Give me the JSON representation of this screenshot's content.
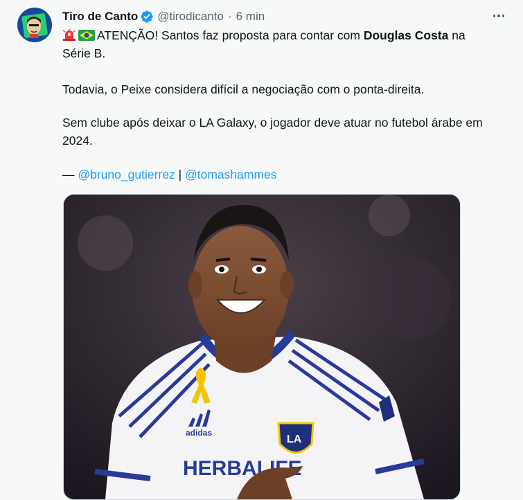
{
  "tweet": {
    "author_name": "Tiro de Canto",
    "handle": "@tirodicanto",
    "separator": "·",
    "time": "6 min",
    "line1_text": "ATENÇÃO! Santos faz proposta para contar com ",
    "line1_bold": "Douglas Costa",
    "line1_after": " na",
    "line2": "Série B.",
    "paragraph2": "Todavia, o Peixe considera difícil a negociação com o ponta-direita.",
    "paragraph3": "Sem clube após deixar o LA Galaxy, o jogador deve atuar no futebol árabe em 2024.",
    "credit_prefix": "— ",
    "mention1": "@bruno_gutierrez",
    "credit_sep": " | ",
    "mention2": "@tomashammes"
  },
  "media": {
    "jersey_brand": "adidas",
    "jersey_sponsor": "HERBALIFE",
    "crest_text": "LA"
  },
  "icons": [
    "siren-icon",
    "brazil-flag-icon",
    "verified-icon",
    "more-icon"
  ],
  "colors": {
    "link": "#1d9bf0",
    "verified": "#1d9bf0",
    "muted": "#536471"
  }
}
